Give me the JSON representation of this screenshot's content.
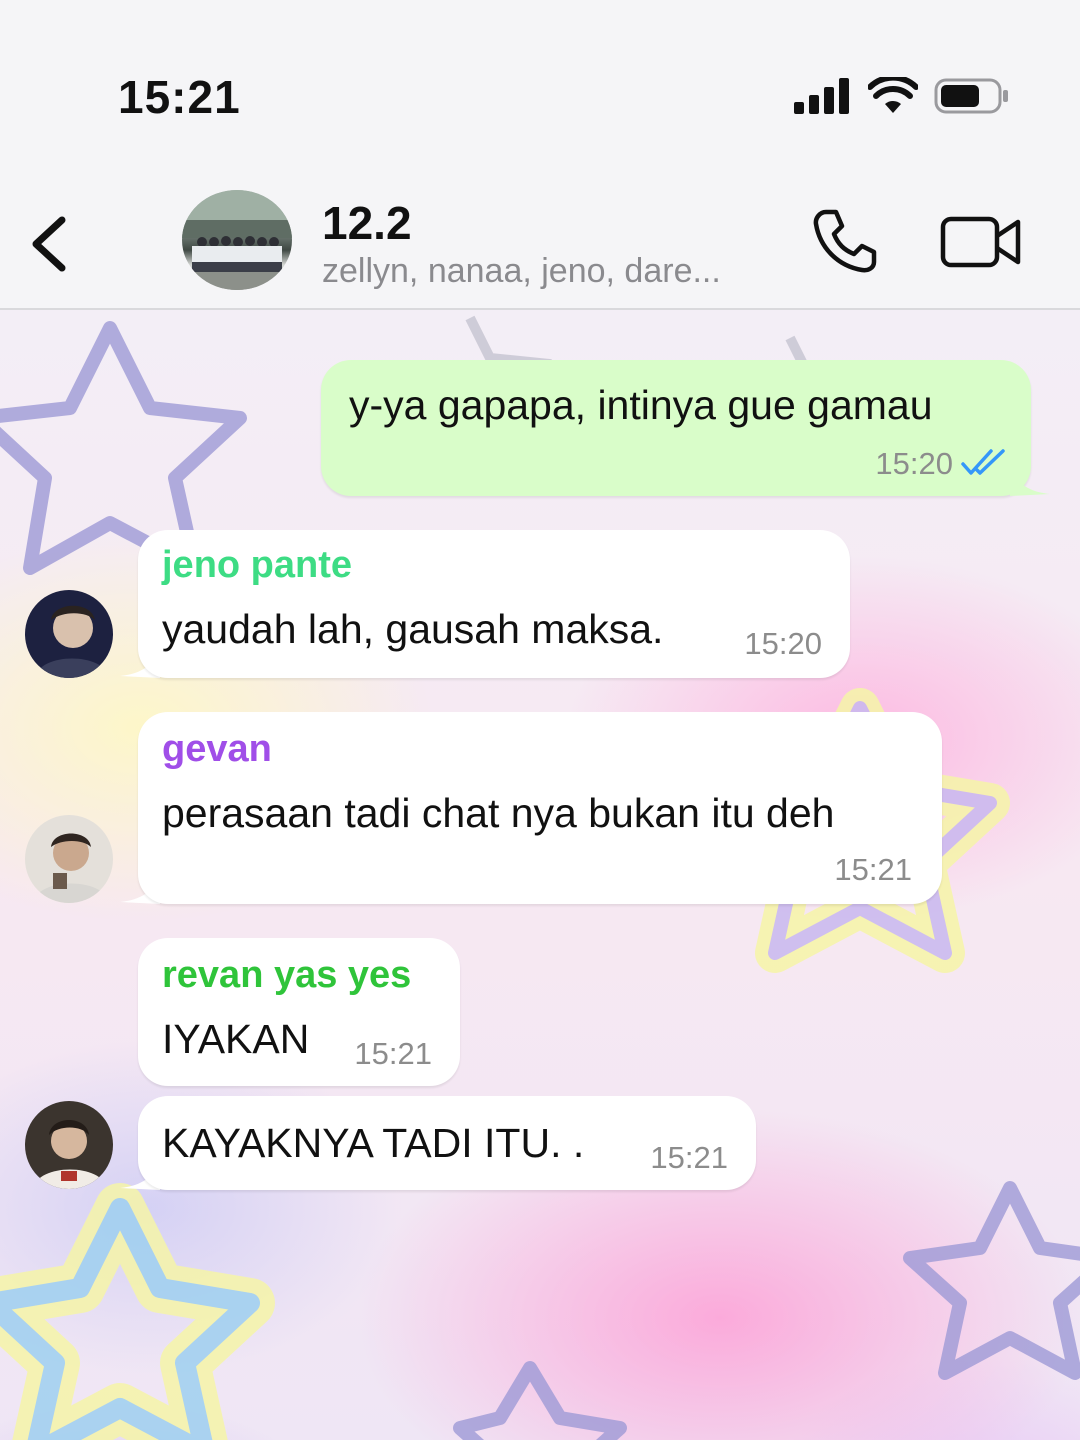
{
  "status_bar": {
    "time": "15:21",
    "icons": [
      "signal-icon",
      "wifi-icon",
      "battery-icon"
    ]
  },
  "header": {
    "back_icon": "chevron-left-icon",
    "group_name": "12.2",
    "members": "zellyn, nanaa, jeno, dare...",
    "call_icon": "phone-icon",
    "video_icon": "video-camera-icon"
  },
  "messages": [
    {
      "direction": "outgoing",
      "text": "y-ya gapapa, intinya gue gamau",
      "time": "15:20",
      "status_icon": "double-check-icon",
      "status_color": "#3497f9"
    },
    {
      "direction": "incoming",
      "sender": "jeno pante",
      "sender_color": "#3ddc84",
      "text": "yaudah lah, gausah maksa.",
      "time": "15:20"
    },
    {
      "direction": "incoming",
      "sender": "gevan",
      "sender_color": "#a04ee8",
      "text": "perasaan tadi chat nya bukan itu deh",
      "time": "15:21"
    },
    {
      "direction": "incoming",
      "sender": "revan yas yes",
      "sender_color": "#2fc43a",
      "text": "IYAKAN",
      "time": "15:21"
    },
    {
      "direction": "incoming",
      "text": "KAYAKNYA TADI ITU. .",
      "time": "15:21"
    }
  ],
  "colors": {
    "outgoing_bubble": "#d9fdc9",
    "incoming_bubble": "#ffffff",
    "header_bg": "#f5f5f7"
  }
}
